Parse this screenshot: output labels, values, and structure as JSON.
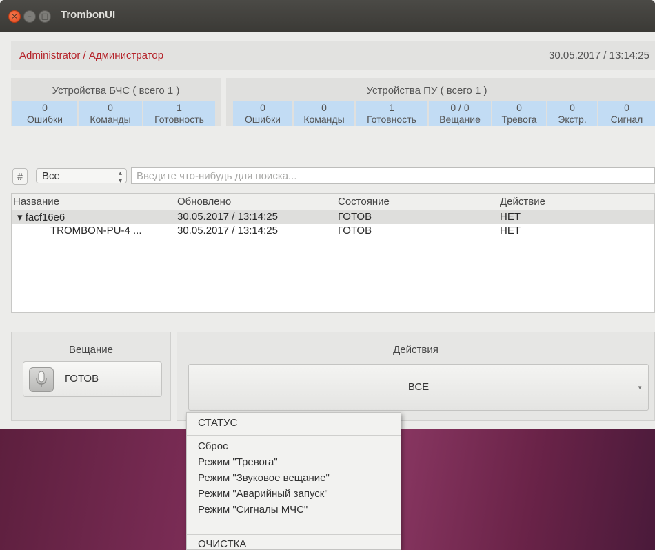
{
  "window": {
    "title": "TrombonUI"
  },
  "header": {
    "user": "Administrator / Администратор",
    "datetime": "30.05.2017 / 13:14:25"
  },
  "bchs": {
    "title": "Устройства БЧС ( всего 1 )",
    "stats": [
      {
        "value": "0",
        "label": "Ошибки"
      },
      {
        "value": "0",
        "label": "Команды"
      },
      {
        "value": "1",
        "label": "Готовность"
      }
    ]
  },
  "pu": {
    "title": "Устройства ПУ ( всего 1 )",
    "stats": [
      {
        "value": "0",
        "label": "Ошибки"
      },
      {
        "value": "0",
        "label": "Команды"
      },
      {
        "value": "1",
        "label": "Готовность"
      },
      {
        "value": "0 / 0",
        "label": "Вещание"
      },
      {
        "value": "0",
        "label": "Тревога"
      },
      {
        "value": "0",
        "label": "Экстр."
      },
      {
        "value": "0",
        "label": "Сигнал"
      }
    ]
  },
  "filter": {
    "hash": "#",
    "combo_value": "Все",
    "search_placeholder": "Введите что-нибудь для поиска..."
  },
  "table": {
    "columns": [
      "Название",
      "Обновлено",
      "Состояние",
      "Действие"
    ],
    "rows": [
      {
        "name": "▾ facf16e6",
        "updated": "30.05.2017 / 13:14:25",
        "state": "ГОТОВ",
        "action": "НЕТ"
      },
      {
        "name": "TROMBON-PU-4 ...",
        "updated": "30.05.2017 / 13:14:25",
        "state": "ГОТОВ",
        "action": "НЕТ"
      }
    ]
  },
  "broadcast": {
    "title": "Вещание",
    "status": "ГОТОВ"
  },
  "actions": {
    "title": "Действия",
    "selected": "ВСЕ"
  },
  "menu": {
    "items": [
      "СТАТУС",
      "Сброс",
      "Режим \"Тревога\"",
      "Режим \"Звуковое вещание\"",
      "Режим \"Аварийный запуск\"",
      "Режим \"Сигналы МЧС\"",
      "ОЧИСТКА"
    ]
  }
}
